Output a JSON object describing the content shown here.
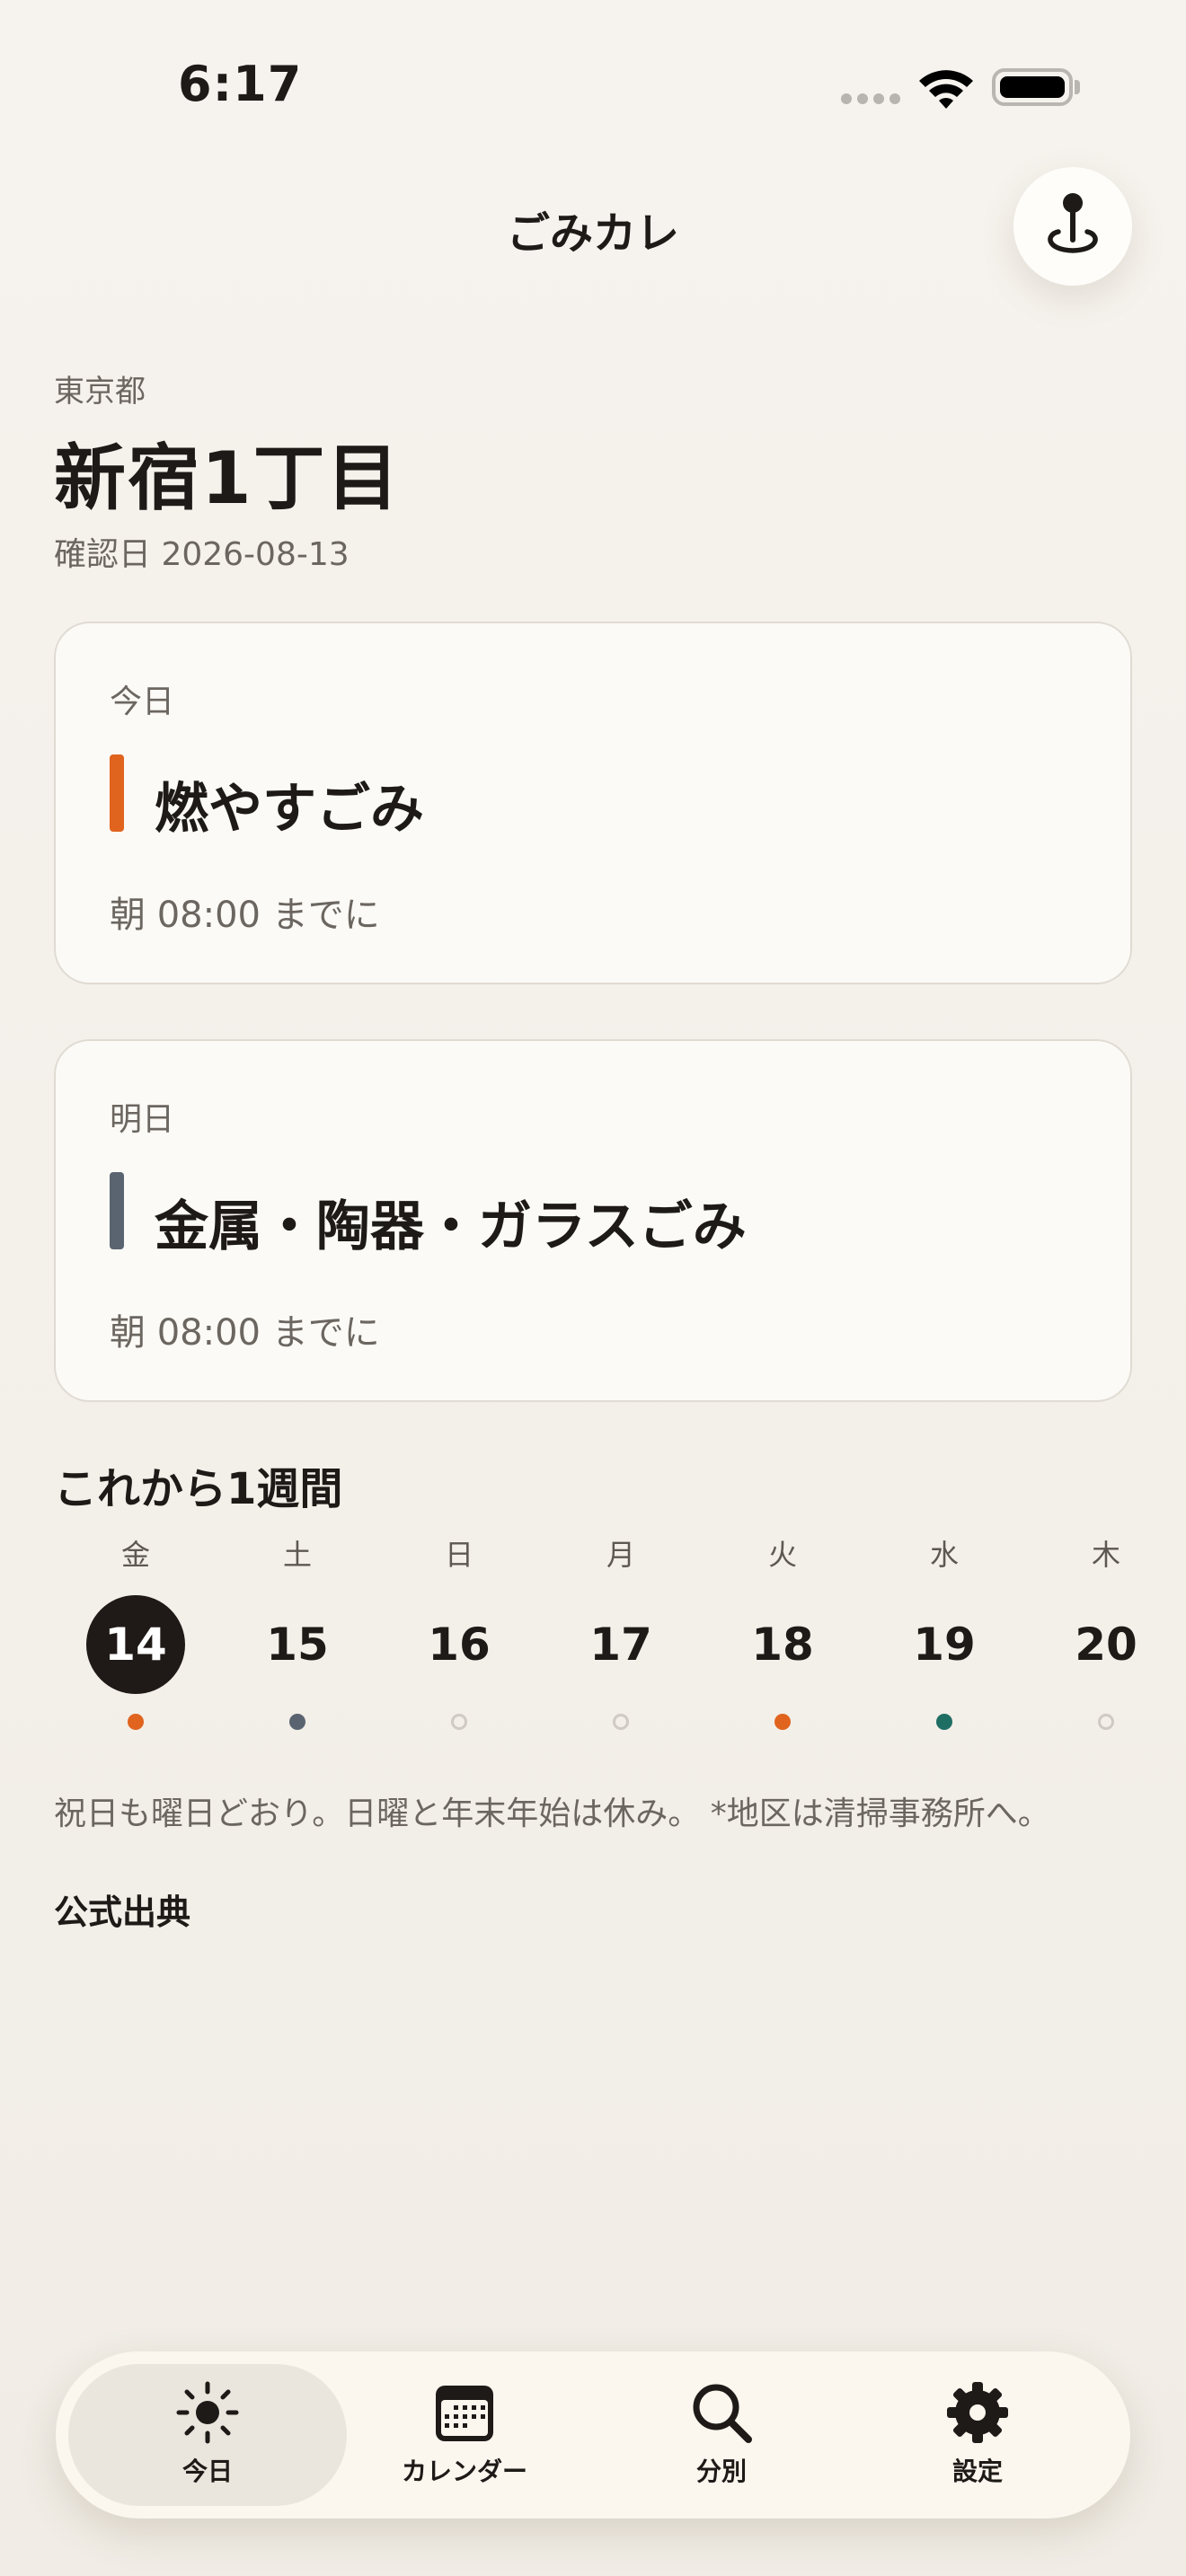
{
  "status_bar": {
    "time": "6:17"
  },
  "header": {
    "title": "ごみカレ",
    "location_icon": "map-pin-icon"
  },
  "area": {
    "prefecture": "東京都",
    "name": "新宿1丁目",
    "confirm_date": "確認日 2026-08-13"
  },
  "cards": [
    {
      "label": "今日",
      "kind": "燃やすごみ",
      "time": "朝 08:00 までに",
      "color": "#e0641e"
    },
    {
      "label": "明日",
      "kind": "金属・陶器・ガラスごみ",
      "time": "朝 08:00 までに",
      "color": "#5a6470"
    }
  ],
  "week": {
    "title": "これから1週間",
    "days": [
      {
        "dow": "金",
        "num": "14",
        "today": true,
        "dot_color": "#e0641e"
      },
      {
        "dow": "土",
        "num": "15",
        "today": false,
        "dot_color": "#5a6470"
      },
      {
        "dow": "日",
        "num": "16",
        "today": false,
        "dot_color": null
      },
      {
        "dow": "月",
        "num": "17",
        "today": false,
        "dot_color": null
      },
      {
        "dow": "火",
        "num": "18",
        "today": false,
        "dot_color": "#e0641e"
      },
      {
        "dow": "水",
        "num": "19",
        "today": false,
        "dot_color": "#1f6e64"
      },
      {
        "dow": "木",
        "num": "20",
        "today": false,
        "dot_color": null
      }
    ]
  },
  "note": "祝日も曜日どおり。日曜と年末年始は休み。 *地区は清掃事務所へ。",
  "sources_label": "公式出典",
  "tabs": [
    {
      "label": "今日",
      "icon": "sun-icon",
      "selected": true
    },
    {
      "label": "カレンダー",
      "icon": "calendar-icon",
      "selected": false
    },
    {
      "label": "分別",
      "icon": "search-icon",
      "selected": false
    },
    {
      "label": "設定",
      "icon": "gear-icon",
      "selected": false
    }
  ]
}
